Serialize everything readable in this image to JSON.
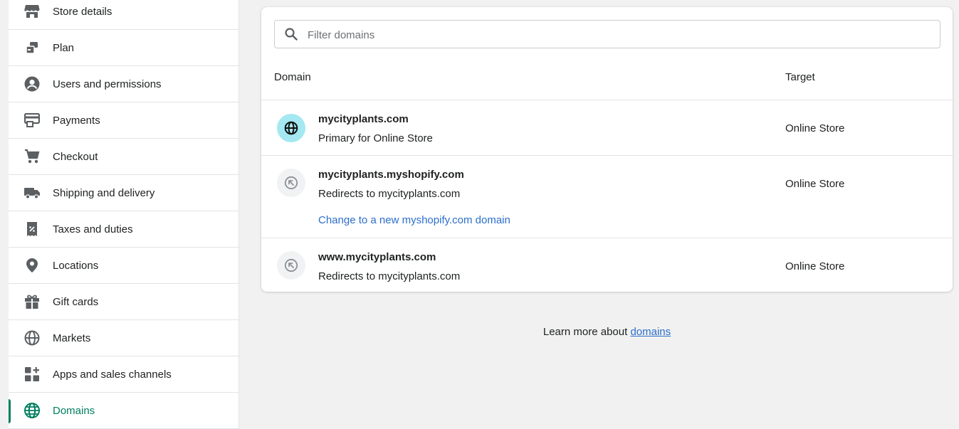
{
  "sidebar": {
    "items": [
      {
        "label": "Store details",
        "icon": "store-icon"
      },
      {
        "label": "Plan",
        "icon": "plan-icon"
      },
      {
        "label": "Users and permissions",
        "icon": "user-icon"
      },
      {
        "label": "Payments",
        "icon": "payments-icon"
      },
      {
        "label": "Checkout",
        "icon": "cart-icon"
      },
      {
        "label": "Shipping and delivery",
        "icon": "truck-icon"
      },
      {
        "label": "Taxes and duties",
        "icon": "receipt-icon"
      },
      {
        "label": "Locations",
        "icon": "location-pin-icon"
      },
      {
        "label": "Gift cards",
        "icon": "gift-icon"
      },
      {
        "label": "Markets",
        "icon": "markets-globe-icon"
      },
      {
        "label": "Apps and sales channels",
        "icon": "apps-icon"
      },
      {
        "label": "Domains",
        "icon": "domains-globe-icon",
        "active": true
      }
    ]
  },
  "domains": {
    "search": {
      "placeholder": "Filter domains"
    },
    "columns": {
      "domain": "Domain",
      "target": "Target"
    },
    "rows": [
      {
        "name": "mycityplants.com",
        "sub": "Primary for Online Store",
        "target": "Online Store",
        "icon": "globe-icon"
      },
      {
        "name": "mycityplants.myshopify.com",
        "sub": "Redirects to mycityplants.com",
        "target": "Online Store",
        "icon": "redirect-icon",
        "link": "Change to a new myshopify.com domain"
      },
      {
        "name": "www.mycityplants.com",
        "sub": "Redirects to mycityplants.com",
        "target": "Online Store",
        "icon": "redirect-icon"
      }
    ]
  },
  "footer": {
    "text": "Learn more about ",
    "link": "domains"
  },
  "colors": {
    "accent": "#008060",
    "link": "#2c6ecb",
    "primary_avatar": "#a4e8f2"
  }
}
